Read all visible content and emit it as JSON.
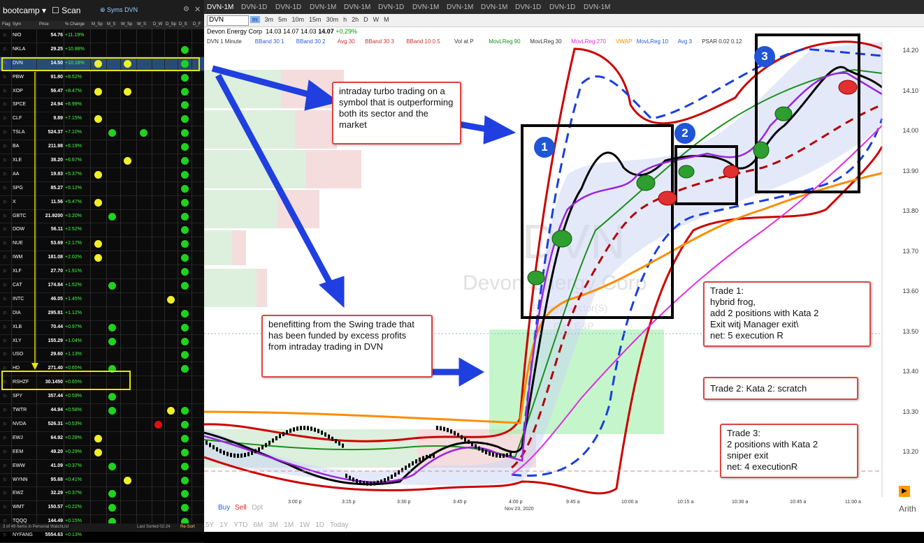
{
  "watchlist": {
    "title": "bootcamp ▾",
    "scan_label": "Scan",
    "syms_label": "Syms",
    "syms_value": "DVN",
    "headers": [
      "Flag",
      "Sym",
      "Price",
      "% Change",
      "M_Sp",
      "M_S",
      "W_Sp",
      "W_S",
      "D_W",
      "D_Sp",
      "D_S",
      "D_F"
    ],
    "rows": [
      {
        "sym": "NIO",
        "price": "54.76",
        "chg": "+11.19%",
        "dots": []
      },
      {
        "sym": "NKLA",
        "price": "29.25",
        "chg": "+10.88%",
        "dots": [
          [
            "D_S",
            "green"
          ]
        ]
      },
      {
        "sym": "DVN",
        "price": "14.50",
        "chg": "+10.18%",
        "dots": [
          [
            "M_Sp",
            "yellow"
          ],
          [
            "W_Sp",
            "yellow"
          ],
          [
            "D_S",
            "green"
          ]
        ]
      },
      {
        "sym": "PBW",
        "price": "91.80",
        "chg": "+8.52%",
        "dots": [
          [
            "D_S",
            "green"
          ]
        ]
      },
      {
        "sym": "XOP",
        "price": "56.47",
        "chg": "+8.47%",
        "dots": [
          [
            "M_Sp",
            "yellow"
          ],
          [
            "W_Sp",
            "yellow"
          ],
          [
            "D_S",
            "green"
          ]
        ]
      },
      {
        "sym": "SPCE",
        "price": "24.94",
        "chg": "+6.99%",
        "dots": [
          [
            "D_S",
            "green"
          ]
        ]
      },
      {
        "sym": "CLF",
        "price": "9.89",
        "chg": "+7.15%",
        "dots": [
          [
            "M_Sp",
            "yellow"
          ],
          [
            "D_S",
            "green"
          ]
        ]
      },
      {
        "sym": "TSLA",
        "price": "524.37",
        "chg": "+7.10%",
        "dots": [
          [
            "M_S",
            "green"
          ],
          [
            "W_S",
            "green"
          ],
          [
            "D_S",
            "green"
          ]
        ]
      },
      {
        "sym": "BA",
        "price": "211.98",
        "chg": "+6.19%",
        "dots": [
          [
            "D_S",
            "green"
          ]
        ]
      },
      {
        "sym": "XLE",
        "price": "38.20",
        "chg": "+6.67%",
        "dots": [
          [
            "W_Sp",
            "yellow"
          ],
          [
            "D_S",
            "green"
          ]
        ]
      },
      {
        "sym": "AA",
        "price": "19.83",
        "chg": "+5.37%",
        "dots": [
          [
            "M_Sp",
            "yellow"
          ],
          [
            "D_S",
            "green"
          ]
        ]
      },
      {
        "sym": "SPG",
        "price": "85.27",
        "chg": "+5.12%",
        "dots": [
          [
            "D_S",
            "green"
          ]
        ]
      },
      {
        "sym": "X",
        "price": "11.56",
        "chg": "+5.47%",
        "dots": [
          [
            "M_Sp",
            "yellow"
          ],
          [
            "D_S",
            "green"
          ]
        ]
      },
      {
        "sym": "GBTC",
        "price": "21.9200",
        "chg": "+3.20%",
        "dots": [
          [
            "M_S",
            "green"
          ],
          [
            "D_S",
            "green"
          ]
        ]
      },
      {
        "sym": "DOW",
        "price": "56.11",
        "chg": "+2.52%",
        "dots": [
          [
            "D_S",
            "green"
          ]
        ]
      },
      {
        "sym": "NUE",
        "price": "53.69",
        "chg": "+2.17%",
        "dots": [
          [
            "M_Sp",
            "yellow"
          ],
          [
            "D_S",
            "green"
          ]
        ]
      },
      {
        "sym": "IWM",
        "price": "181.08",
        "chg": "+2.02%",
        "dots": [
          [
            "M_Sp",
            "yellow"
          ],
          [
            "D_S",
            "green"
          ]
        ]
      },
      {
        "sym": "XLF",
        "price": "27.70",
        "chg": "+1.91%",
        "dots": [
          [
            "D_S",
            "green"
          ]
        ]
      },
      {
        "sym": "CAT",
        "price": "174.84",
        "chg": "+1.52%",
        "dots": [
          [
            "M_S",
            "green"
          ],
          [
            "D_S",
            "green"
          ]
        ]
      },
      {
        "sym": "INTC",
        "price": "46.05",
        "chg": "+1.45%",
        "dots": [
          [
            "D_Sp",
            "yellow"
          ]
        ]
      },
      {
        "sym": "DIA",
        "price": "295.81",
        "chg": "+1.12%",
        "dots": [
          [
            "D_S",
            "green"
          ]
        ]
      },
      {
        "sym": "XLB",
        "price": "70.44",
        "chg": "+0.97%",
        "dots": [
          [
            "M_S",
            "green"
          ],
          [
            "D_S",
            "green"
          ]
        ]
      },
      {
        "sym": "XLY",
        "price": "155.29",
        "chg": "+1.04%",
        "dots": [
          [
            "M_S",
            "green"
          ],
          [
            "D_S",
            "green"
          ]
        ]
      },
      {
        "sym": "USO",
        "price": "29.60",
        "chg": "+1.13%",
        "dots": [
          [
            "D_S",
            "green"
          ]
        ]
      },
      {
        "sym": "HD",
        "price": "271.40",
        "chg": "+0.65%",
        "dots": [
          [
            "M_S",
            "green"
          ],
          [
            "D_S",
            "green"
          ]
        ]
      },
      {
        "sym": "RSHZF",
        "price": "30.1450",
        "chg": "+0.65%",
        "dots": []
      },
      {
        "sym": "SPY",
        "price": "357.44",
        "chg": "+0.59%",
        "dots": [
          [
            "M_S",
            "green"
          ]
        ]
      },
      {
        "sym": "TWTR",
        "price": "44.94",
        "chg": "+0.58%",
        "dots": [
          [
            "M_S",
            "green"
          ],
          [
            "D_Sp",
            "yellow"
          ],
          [
            "D_S",
            "green"
          ]
        ]
      },
      {
        "sym": "NVDA",
        "price": "526.31",
        "chg": "+0.53%",
        "dots": [
          [
            "D_W",
            "red"
          ],
          [
            "D_S",
            "green"
          ]
        ]
      },
      {
        "sym": "EWJ",
        "price": "64.92",
        "chg": "+0.28%",
        "dots": [
          [
            "M_Sp",
            "yellow"
          ],
          [
            "D_S",
            "green"
          ]
        ]
      },
      {
        "sym": "EEM",
        "price": "49.20",
        "chg": "+0.29%",
        "dots": [
          [
            "M_Sp",
            "yellow"
          ],
          [
            "D_S",
            "green"
          ]
        ]
      },
      {
        "sym": "EWW",
        "price": "41.09",
        "chg": "+0.37%",
        "dots": [
          [
            "M_S",
            "green"
          ],
          [
            "D_S",
            "green"
          ]
        ]
      },
      {
        "sym": "WYNN",
        "price": "95.68",
        "chg": "+0.41%",
        "dots": [
          [
            "W_Sp",
            "yellow"
          ],
          [
            "D_S",
            "green"
          ]
        ]
      },
      {
        "sym": "EWZ",
        "price": "32.29",
        "chg": "+0.37%",
        "dots": [
          [
            "M_S",
            "green"
          ],
          [
            "D_S",
            "green"
          ]
        ]
      },
      {
        "sym": "WMT",
        "price": "150.57",
        "chg": "+0.22%",
        "dots": [
          [
            "M_S",
            "green"
          ],
          [
            "D_S",
            "green"
          ]
        ]
      },
      {
        "sym": "TQQQ",
        "price": "144.49",
        "chg": "+0.15%",
        "dots": [
          [
            "M_S",
            "green"
          ],
          [
            "D_S",
            "green"
          ]
        ]
      },
      {
        "sym": "NYFANG",
        "price": "5554.63",
        "chg": "+0.13%",
        "dots": []
      }
    ],
    "footer": "3 of 49 Items in Personal WatchList",
    "footer_right": "Last Sorted 02:24",
    "resort": "Re-Sort"
  },
  "tabs": [
    "DVN-1M",
    "DVN-1D",
    "DVN-1D",
    "DVN-1M",
    "DVN-1M",
    "DVN-1D",
    "DVN-1M",
    "DVN-1M",
    "DVN-1M",
    "DVN-1D",
    "DVN-1D",
    "DVN-1M"
  ],
  "toolbar": {
    "symbol": "DVN",
    "intervals": [
      "m",
      "3m",
      "5m",
      "10m",
      "15m",
      "30m",
      "h",
      "2h",
      "D",
      "W",
      "M"
    ]
  },
  "quote": {
    "name": "Devon Energy Corp",
    "o": "14.03",
    "h": "14.07",
    "l": "14.03",
    "c": "14.07",
    "chg": "+0.29%"
  },
  "studies": [
    "DVN 1 Minute",
    "BBand 30 1",
    "BBand 30 2",
    "Avg 30",
    "BBand 30 3",
    "BBand 10 0.5",
    "Vol at P",
    "MovLReg 90",
    "MovLReg 30",
    "MovLReg 270",
    "VWAP",
    "MovLReg 10",
    "Avg 3",
    "PSAR 0.02 0.12"
  ],
  "price_axis": [
    "14.20",
    "14.10",
    "14.00",
    "13.90",
    "13.80",
    "13.70",
    "13.60",
    "13.50",
    "13.40",
    "13.30",
    "13.20"
  ],
  "time_axis": [
    "3:00 p",
    "3:15 p",
    "3:30 p",
    "3:45 p",
    "4:00 p",
    "9:45 a",
    "10:00 a",
    "10:15 a",
    "10:30 a",
    "10:45 a",
    "11:00 a"
  ],
  "date_label": "Nov 23, 2020",
  "watermark": {
    "sym": "DVN",
    "name": "Devon Energy Corp",
    "sector": "Energy Sector(S)",
    "industry": "Gas E&P"
  },
  "notes": {
    "turbo": "intraday turbo trading on a symbol that is outperforming both its sector and the market",
    "swing": "benefitting from the Swing trade that has been funded by excess profits from intraday trading in DVN",
    "trade1": [
      "Trade 1:",
      "hybrid frog,",
      "add 2 positions with Kata 2",
      "Exit witj Manager exit\\",
      "net: 5 execution R"
    ],
    "trade2": "Trade 2: Kata 2: scratch",
    "trade3": [
      "Trade 3:",
      "2 positions with Kata 2",
      "sniper exit",
      "net: 4 executionR"
    ]
  },
  "trade_numbers": [
    "1",
    "2",
    "3"
  ],
  "bottom_bar": {
    "buy": "Buy",
    "sell": "Sell",
    "opt": "Opt",
    "ranges": [
      "5Y",
      "1Y",
      "YTD",
      "6M",
      "3M",
      "1M",
      "1W",
      "1D",
      "Today"
    ],
    "arith": "Arith"
  },
  "colors": {
    "arrow": "#1f3fe0",
    "note_border": "#d44",
    "box": "#000",
    "highlight": "#e6e600"
  }
}
